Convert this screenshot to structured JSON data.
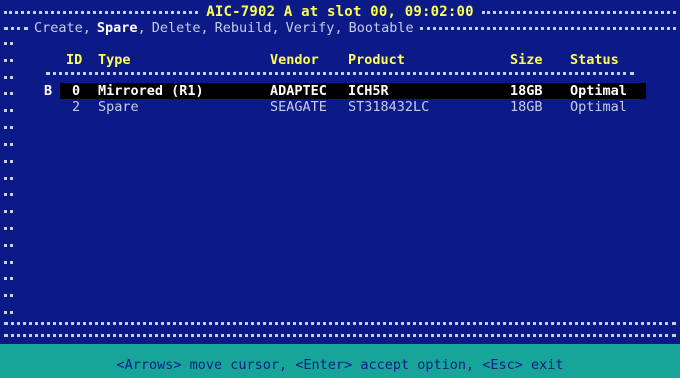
{
  "title": "AIC-7902 A at slot 00, 09:02:00",
  "menu": {
    "items": [
      {
        "label": "Create",
        "active": false
      },
      {
        "label": "Spare",
        "active": true
      },
      {
        "label": "Delete",
        "active": false
      },
      {
        "label": "Rebuild",
        "active": false
      },
      {
        "label": "Verify",
        "active": false
      },
      {
        "label": "Bootable",
        "active": false
      }
    ],
    "separator": ","
  },
  "table": {
    "headers": {
      "id": "ID",
      "type": "Type",
      "vendor": "Vendor",
      "product": "Product",
      "size": "Size",
      "status": "Status"
    },
    "rows": [
      {
        "marker": "B",
        "id": "0",
        "type": "Mirrored (R1)",
        "vendor": "ADAPTEC",
        "product": "ICH5R",
        "size": "18GB",
        "status": "Optimal",
        "selected": true
      },
      {
        "marker": "",
        "id": "2",
        "type": "Spare",
        "vendor": "SEAGATE",
        "product": "ST318432LC",
        "size": "18GB",
        "status": "Optimal",
        "selected": false
      }
    ]
  },
  "statusbar": {
    "text": "<Arrows> move cursor, <Enter> accept option, <Esc> exit"
  },
  "colors": {
    "background": "#0b1a86",
    "title": "#ffff55",
    "text": "#c8cde6",
    "statusbar": "#17a59a",
    "selection": "#000000"
  }
}
